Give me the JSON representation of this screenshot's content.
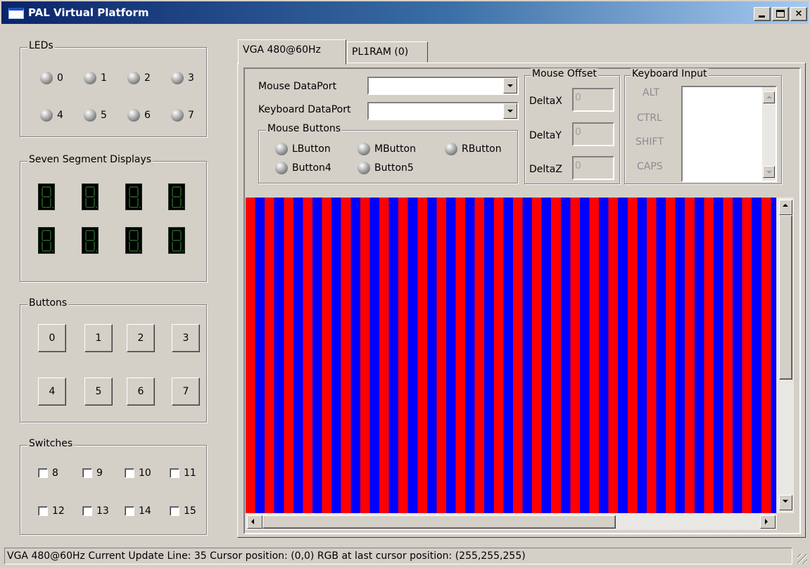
{
  "window": {
    "title": "PAL Virtual Platform",
    "controls": {
      "minimize": "_",
      "maximize": "□",
      "close": "×"
    }
  },
  "leds": {
    "legend": "LEDs",
    "items": [
      "0",
      "1",
      "2",
      "3",
      "4",
      "5",
      "6",
      "7"
    ]
  },
  "seven_segment": {
    "legend": "Seven Segment Displays",
    "count": 8
  },
  "buttons": {
    "legend": "Buttons",
    "items": [
      "0",
      "1",
      "2",
      "3",
      "4",
      "5",
      "6",
      "7"
    ]
  },
  "switches": {
    "legend": "Switches",
    "items": [
      "8",
      "9",
      "10",
      "11",
      "12",
      "13",
      "14",
      "15"
    ]
  },
  "tabs": [
    {
      "label": "VGA 480@60Hz",
      "active": true
    },
    {
      "label": "PL1RAM (0)",
      "active": false
    }
  ],
  "vga": {
    "mouse_dataport_label": "Mouse DataPort",
    "mouse_dataport_value": "",
    "keyboard_dataport_label": "Keyboard DataPort",
    "keyboard_dataport_value": "",
    "mouse_buttons": {
      "legend": "Mouse Buttons",
      "items": [
        "LButton",
        "MButton",
        "RButton",
        "Button4",
        "Button5"
      ]
    },
    "mouse_offset": {
      "legend": "Mouse Offset",
      "deltax_label": "DeltaX",
      "deltax_value": "0",
      "deltay_label": "DeltaY",
      "deltay_value": "0",
      "deltaz_label": "DeltaZ",
      "deltaz_value": "0"
    },
    "keyboard_input": {
      "legend": "Keyboard Input",
      "modifiers": [
        "ALT",
        "CTRL",
        "SHIFT",
        "CAPS"
      ]
    },
    "display_colors": {
      "stripe_a": "#ff0000",
      "stripe_b": "#0000ff"
    }
  },
  "status": {
    "text": "VGA 480@60Hz  Current Update Line: 35  Cursor position: (0,0)  RGB at last cursor position: (255,255,255)"
  },
  "colors": {
    "title_gradient_start": "#0a246a",
    "title_gradient_end": "#a6caf0",
    "face": "#d4d0c8"
  }
}
